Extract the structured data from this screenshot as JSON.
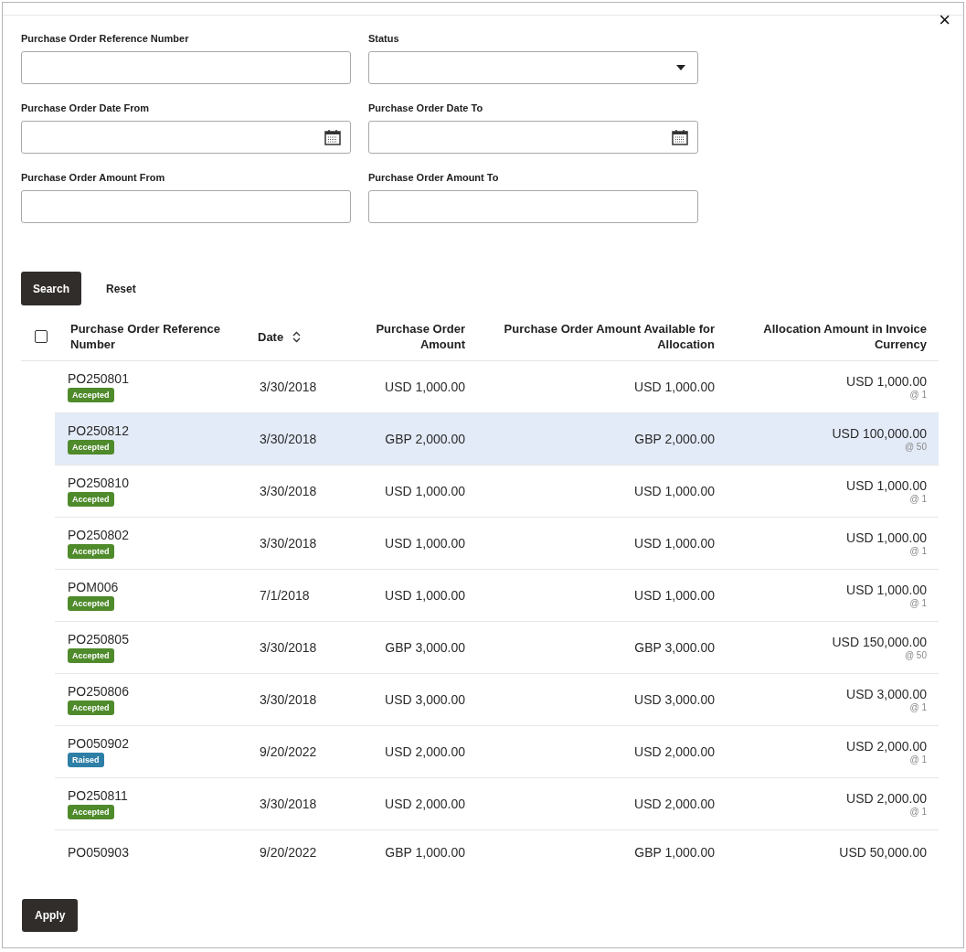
{
  "close_label": "×",
  "filters": [
    {
      "kind": "text",
      "label": "Purchase Order Reference Number"
    },
    {
      "kind": "select",
      "label": "Status"
    },
    {
      "kind": "date",
      "label": "Purchase Order Date From"
    },
    {
      "kind": "date",
      "label": "Purchase Order Date To"
    },
    {
      "kind": "text",
      "label": "Purchase Order Amount From"
    },
    {
      "kind": "text",
      "label": "Purchase Order Amount To"
    }
  ],
  "actions": [
    {
      "kind": "primary",
      "label": "Search"
    },
    {
      "kind": "plain",
      "label": "Reset"
    }
  ],
  "table": {
    "select_all_checked": false,
    "columns": [
      {
        "label": "Purchase Order Reference Number",
        "sortable": false
      },
      {
        "label": "Date",
        "sortable": true
      },
      {
        "label": "Purchase Order Amount",
        "sortable": false
      },
      {
        "label": "Purchase Order Amount Available for Allocation",
        "sortable": false
      },
      {
        "label": "Allocation Amount in Invoice Currency",
        "sortable": false
      }
    ],
    "rows": [
      {
        "reference": "PO250801",
        "status": {
          "kind": "accepted",
          "label": "Accepted"
        },
        "date": "3/30/2018",
        "amount": "USD 1,000.00",
        "available": "USD 1,000.00",
        "allocation": "USD 1,000.00",
        "rate": "@ 1",
        "selected": false
      },
      {
        "reference": "PO250812",
        "status": {
          "kind": "accepted",
          "label": "Accepted"
        },
        "date": "3/30/2018",
        "amount": "GBP 2,000.00",
        "available": "GBP 2,000.00",
        "allocation": "USD 100,000.00",
        "rate": "@ 50",
        "selected": true
      },
      {
        "reference": "PO250810",
        "status": {
          "kind": "accepted",
          "label": "Accepted"
        },
        "date": "3/30/2018",
        "amount": "USD 1,000.00",
        "available": "USD 1,000.00",
        "allocation": "USD 1,000.00",
        "rate": "@ 1",
        "selected": false
      },
      {
        "reference": "PO250802",
        "status": {
          "kind": "accepted",
          "label": "Accepted"
        },
        "date": "3/30/2018",
        "amount": "USD 1,000.00",
        "available": "USD 1,000.00",
        "allocation": "USD 1,000.00",
        "rate": "@ 1",
        "selected": false
      },
      {
        "reference": "POM006",
        "status": {
          "kind": "accepted",
          "label": "Accepted"
        },
        "date": "7/1/2018",
        "amount": "USD 1,000.00",
        "available": "USD 1,000.00",
        "allocation": "USD 1,000.00",
        "rate": "@ 1",
        "selected": false
      },
      {
        "reference": "PO250805",
        "status": {
          "kind": "accepted",
          "label": "Accepted"
        },
        "date": "3/30/2018",
        "amount": "GBP 3,000.00",
        "available": "GBP 3,000.00",
        "allocation": "USD 150,000.00",
        "rate": "@ 50",
        "selected": false
      },
      {
        "reference": "PO250806",
        "status": {
          "kind": "accepted",
          "label": "Accepted"
        },
        "date": "3/30/2018",
        "amount": "USD 3,000.00",
        "available": "USD 3,000.00",
        "allocation": "USD 3,000.00",
        "rate": "@ 1",
        "selected": false
      },
      {
        "reference": "PO050902",
        "status": {
          "kind": "raised",
          "label": "Raised"
        },
        "date": "9/20/2022",
        "amount": "USD 2,000.00",
        "available": "USD 2,000.00",
        "allocation": "USD 2,000.00",
        "rate": "@ 1",
        "selected": false
      },
      {
        "reference": "PO250811",
        "status": {
          "kind": "accepted",
          "label": "Accepted"
        },
        "date": "3/30/2018",
        "amount": "USD 2,000.00",
        "available": "USD 2,000.00",
        "allocation": "USD 2,000.00",
        "rate": "@ 1",
        "selected": false
      },
      {
        "reference": "PO050903",
        "date": "9/20/2022",
        "amount": "GBP 1,000.00",
        "available": "GBP 1,000.00",
        "allocation": "USD 50,000.00",
        "selected": false
      }
    ]
  },
  "apply_label": "Apply"
}
